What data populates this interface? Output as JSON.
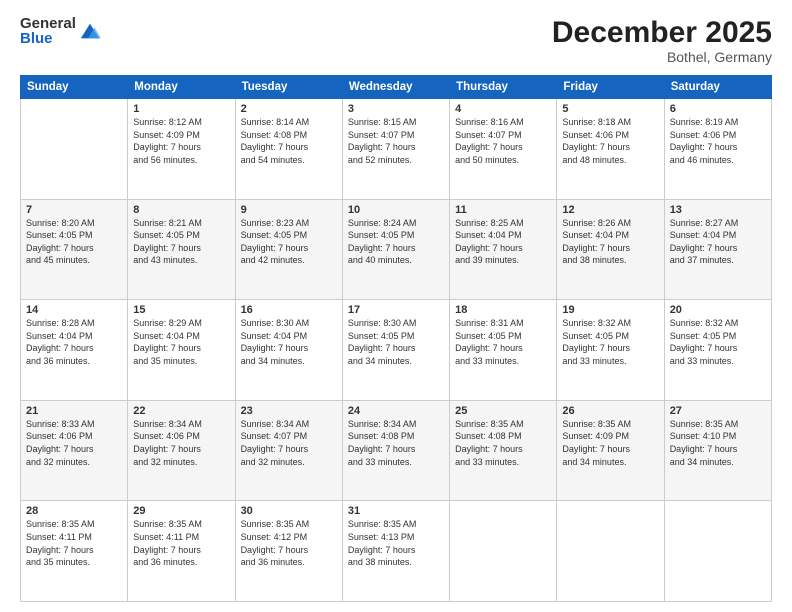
{
  "logo": {
    "general": "General",
    "blue": "Blue"
  },
  "header": {
    "month_year": "December 2025",
    "location": "Bothel, Germany"
  },
  "weekdays": [
    "Sunday",
    "Monday",
    "Tuesday",
    "Wednesday",
    "Thursday",
    "Friday",
    "Saturday"
  ],
  "weeks": [
    [
      {
        "day": "",
        "info": ""
      },
      {
        "day": "1",
        "info": "Sunrise: 8:12 AM\nSunset: 4:09 PM\nDaylight: 7 hours\nand 56 minutes."
      },
      {
        "day": "2",
        "info": "Sunrise: 8:14 AM\nSunset: 4:08 PM\nDaylight: 7 hours\nand 54 minutes."
      },
      {
        "day": "3",
        "info": "Sunrise: 8:15 AM\nSunset: 4:07 PM\nDaylight: 7 hours\nand 52 minutes."
      },
      {
        "day": "4",
        "info": "Sunrise: 8:16 AM\nSunset: 4:07 PM\nDaylight: 7 hours\nand 50 minutes."
      },
      {
        "day": "5",
        "info": "Sunrise: 8:18 AM\nSunset: 4:06 PM\nDaylight: 7 hours\nand 48 minutes."
      },
      {
        "day": "6",
        "info": "Sunrise: 8:19 AM\nSunset: 4:06 PM\nDaylight: 7 hours\nand 46 minutes."
      }
    ],
    [
      {
        "day": "7",
        "info": "Sunrise: 8:20 AM\nSunset: 4:05 PM\nDaylight: 7 hours\nand 45 minutes."
      },
      {
        "day": "8",
        "info": "Sunrise: 8:21 AM\nSunset: 4:05 PM\nDaylight: 7 hours\nand 43 minutes."
      },
      {
        "day": "9",
        "info": "Sunrise: 8:23 AM\nSunset: 4:05 PM\nDaylight: 7 hours\nand 42 minutes."
      },
      {
        "day": "10",
        "info": "Sunrise: 8:24 AM\nSunset: 4:05 PM\nDaylight: 7 hours\nand 40 minutes."
      },
      {
        "day": "11",
        "info": "Sunrise: 8:25 AM\nSunset: 4:04 PM\nDaylight: 7 hours\nand 39 minutes."
      },
      {
        "day": "12",
        "info": "Sunrise: 8:26 AM\nSunset: 4:04 PM\nDaylight: 7 hours\nand 38 minutes."
      },
      {
        "day": "13",
        "info": "Sunrise: 8:27 AM\nSunset: 4:04 PM\nDaylight: 7 hours\nand 37 minutes."
      }
    ],
    [
      {
        "day": "14",
        "info": "Sunrise: 8:28 AM\nSunset: 4:04 PM\nDaylight: 7 hours\nand 36 minutes."
      },
      {
        "day": "15",
        "info": "Sunrise: 8:29 AM\nSunset: 4:04 PM\nDaylight: 7 hours\nand 35 minutes."
      },
      {
        "day": "16",
        "info": "Sunrise: 8:30 AM\nSunset: 4:04 PM\nDaylight: 7 hours\nand 34 minutes."
      },
      {
        "day": "17",
        "info": "Sunrise: 8:30 AM\nSunset: 4:05 PM\nDaylight: 7 hours\nand 34 minutes."
      },
      {
        "day": "18",
        "info": "Sunrise: 8:31 AM\nSunset: 4:05 PM\nDaylight: 7 hours\nand 33 minutes."
      },
      {
        "day": "19",
        "info": "Sunrise: 8:32 AM\nSunset: 4:05 PM\nDaylight: 7 hours\nand 33 minutes."
      },
      {
        "day": "20",
        "info": "Sunrise: 8:32 AM\nSunset: 4:05 PM\nDaylight: 7 hours\nand 33 minutes."
      }
    ],
    [
      {
        "day": "21",
        "info": "Sunrise: 8:33 AM\nSunset: 4:06 PM\nDaylight: 7 hours\nand 32 minutes."
      },
      {
        "day": "22",
        "info": "Sunrise: 8:34 AM\nSunset: 4:06 PM\nDaylight: 7 hours\nand 32 minutes."
      },
      {
        "day": "23",
        "info": "Sunrise: 8:34 AM\nSunset: 4:07 PM\nDaylight: 7 hours\nand 32 minutes."
      },
      {
        "day": "24",
        "info": "Sunrise: 8:34 AM\nSunset: 4:08 PM\nDaylight: 7 hours\nand 33 minutes."
      },
      {
        "day": "25",
        "info": "Sunrise: 8:35 AM\nSunset: 4:08 PM\nDaylight: 7 hours\nand 33 minutes."
      },
      {
        "day": "26",
        "info": "Sunrise: 8:35 AM\nSunset: 4:09 PM\nDaylight: 7 hours\nand 34 minutes."
      },
      {
        "day": "27",
        "info": "Sunrise: 8:35 AM\nSunset: 4:10 PM\nDaylight: 7 hours\nand 34 minutes."
      }
    ],
    [
      {
        "day": "28",
        "info": "Sunrise: 8:35 AM\nSunset: 4:11 PM\nDaylight: 7 hours\nand 35 minutes."
      },
      {
        "day": "29",
        "info": "Sunrise: 8:35 AM\nSunset: 4:11 PM\nDaylight: 7 hours\nand 36 minutes."
      },
      {
        "day": "30",
        "info": "Sunrise: 8:35 AM\nSunset: 4:12 PM\nDaylight: 7 hours\nand 36 minutes."
      },
      {
        "day": "31",
        "info": "Sunrise: 8:35 AM\nSunset: 4:13 PM\nDaylight: 7 hours\nand 38 minutes."
      },
      {
        "day": "",
        "info": ""
      },
      {
        "day": "",
        "info": ""
      },
      {
        "day": "",
        "info": ""
      }
    ]
  ]
}
